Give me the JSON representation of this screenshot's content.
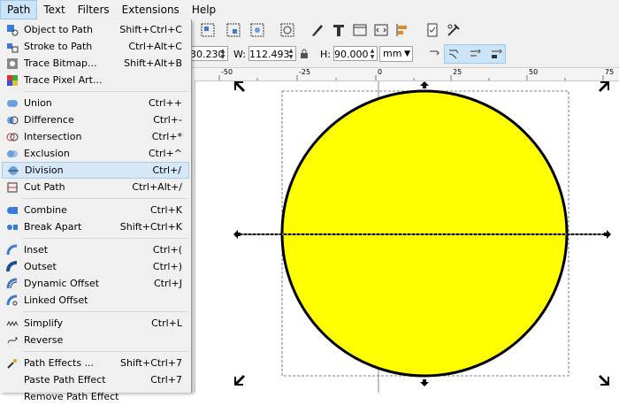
{
  "menubar": {
    "items": [
      {
        "label": "Path"
      },
      {
        "label": "Text"
      },
      {
        "label": "Filters"
      },
      {
        "label": "Extensions"
      },
      {
        "label": "Help"
      }
    ]
  },
  "toolbar": {
    "x_value": "30.230",
    "w_label": "W:",
    "w_value": "112.493",
    "h_label": "H:",
    "h_value": "90.000",
    "unit": "mm"
  },
  "ruler": {
    "ticks": [
      "-50",
      "-25",
      "0",
      "25",
      "50",
      "75"
    ]
  },
  "menu": {
    "groups": [
      [
        {
          "label": "Object to Path",
          "shortcut": "Shift+Ctrl+C",
          "icon": "object-to-path-icon"
        },
        {
          "label": "Stroke to Path",
          "shortcut": "Ctrl+Alt+C",
          "icon": "stroke-to-path-icon"
        },
        {
          "label": "Trace Bitmap...",
          "shortcut": "Shift+Alt+B",
          "icon": "trace-bitmap-icon"
        },
        {
          "label": "Trace Pixel Art...",
          "shortcut": "",
          "icon": "trace-pixel-art-icon"
        }
      ],
      [
        {
          "label": "Union",
          "shortcut": "Ctrl++",
          "icon": "union-icon"
        },
        {
          "label": "Difference",
          "shortcut": "Ctrl+-",
          "icon": "difference-icon"
        },
        {
          "label": "Intersection",
          "shortcut": "Ctrl+*",
          "icon": "intersection-icon"
        },
        {
          "label": "Exclusion",
          "shortcut": "Ctrl+^",
          "icon": "exclusion-icon"
        },
        {
          "label": "Division",
          "shortcut": "Ctrl+/",
          "icon": "division-icon",
          "highlighted": true
        },
        {
          "label": "Cut Path",
          "shortcut": "Ctrl+Alt+/",
          "icon": "cut-path-icon"
        }
      ],
      [
        {
          "label": "Combine",
          "shortcut": "Ctrl+K",
          "icon": "combine-icon"
        },
        {
          "label": "Break Apart",
          "shortcut": "Shift+Ctrl+K",
          "icon": "break-apart-icon"
        }
      ],
      [
        {
          "label": "Inset",
          "shortcut": "Ctrl+(",
          "icon": "inset-icon"
        },
        {
          "label": "Outset",
          "shortcut": "Ctrl+)",
          "icon": "outset-icon"
        },
        {
          "label": "Dynamic Offset",
          "shortcut": "Ctrl+J",
          "icon": "dynamic-offset-icon"
        },
        {
          "label": "Linked Offset",
          "shortcut": "",
          "icon": "linked-offset-icon"
        }
      ],
      [
        {
          "label": "Simplify",
          "shortcut": "Ctrl+L",
          "icon": "simplify-icon"
        },
        {
          "label": "Reverse",
          "shortcut": "",
          "icon": "reverse-icon"
        }
      ],
      [
        {
          "label": "Path Effects ...",
          "shortcut": "Shift+Ctrl+7",
          "icon": "path-effects-icon"
        },
        {
          "label": "Paste Path Effect",
          "shortcut": "Ctrl+7",
          "icon": ""
        },
        {
          "label": "Remove Path Effect",
          "shortcut": "",
          "icon": ""
        }
      ]
    ]
  },
  "colors": {
    "fill": "#ffff00",
    "stroke": "#000000",
    "highlight": "#d6e8f7"
  }
}
